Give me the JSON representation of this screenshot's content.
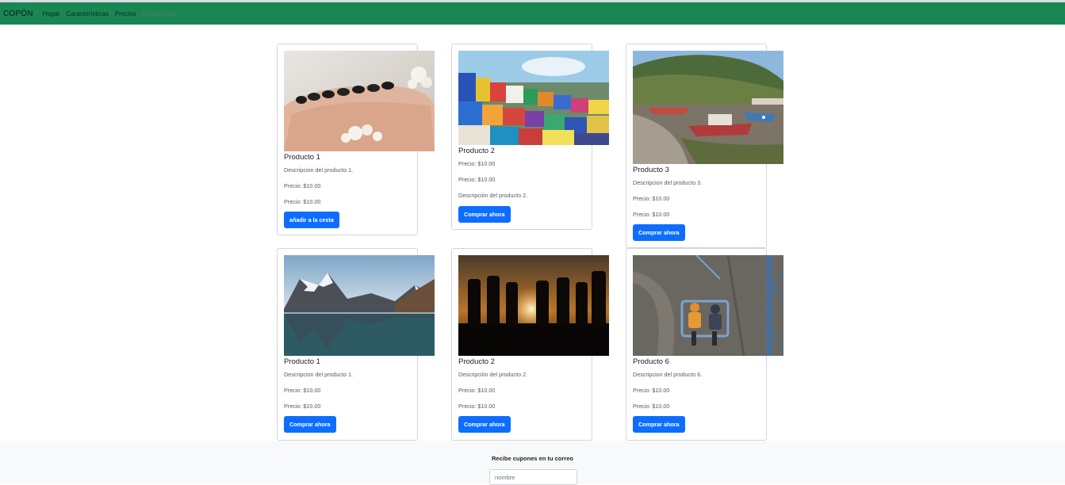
{
  "navbar": {
    "brand": "COPÓN",
    "links": [
      "Hogar",
      "Características",
      "Precios",
      "Desactivado"
    ],
    "color": "#198754"
  },
  "cards": [
    {
      "title": "Producto 1",
      "lines": [
        "Descripcion del producto 1.",
        "Precio: $10.00",
        "Precio: $10.00"
      ],
      "button": "añadir a la cesta"
    },
    {
      "title": "Producto 2",
      "lines": [
        "Precio: $10.00",
        "Precio: $10.00",
        "Descripción del producto 2."
      ],
      "button": "Comprar ahora"
    },
    {
      "title": "Producto 3",
      "lines": [
        "Descripcion del producto 3.",
        "Precio: $10.00",
        "Precio: $10.00"
      ],
      "button": "Comprar ahora"
    },
    {
      "title": "Producto 1",
      "lines": [
        "Descripcion del producto 1.",
        "Precio: $10.00",
        "Precio: $10.00"
      ],
      "button": "Comprar ahora"
    },
    {
      "title": "Producto 2",
      "lines": [
        "Descripción del producto 2.",
        "Precio: $10.00",
        "Precio: $10.00"
      ],
      "button": "Comprar ahora"
    },
    {
      "title": "Producto 6",
      "lines": [
        "Descripcion del producto 6.",
        "Precio: $10.00",
        "Precio: $10.00"
      ],
      "button": "Comprar ahora"
    }
  ],
  "footer": {
    "title": "Recibe cupones en tu correo",
    "input_placeholder": "nombre"
  },
  "colors": {
    "button": "#0d6efd",
    "footer_bg": "#f8f9fa"
  }
}
